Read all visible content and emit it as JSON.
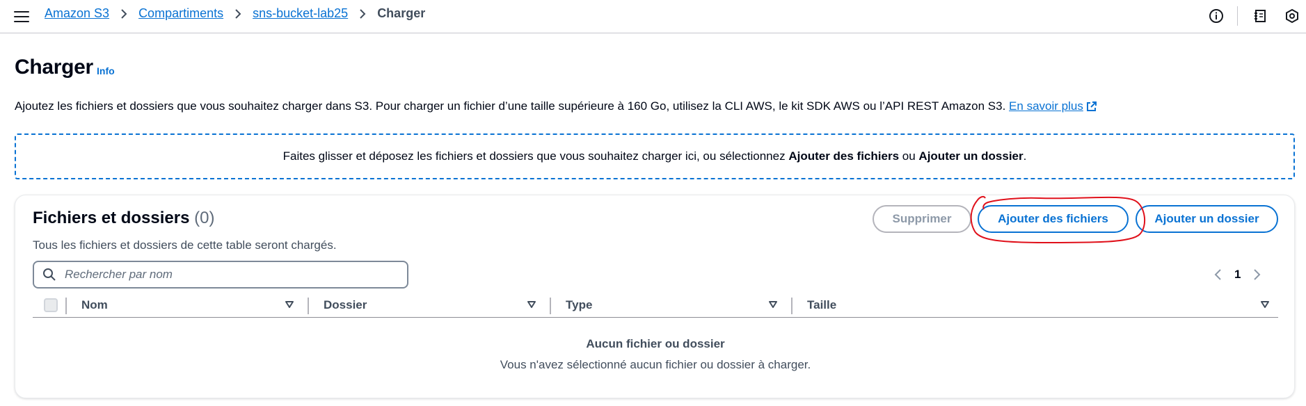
{
  "breadcrumb": {
    "items": [
      "Amazon S3",
      "Compartiments",
      "sns-bucket-lab25"
    ],
    "current": "Charger"
  },
  "header": {
    "title": "Charger",
    "info": "Info",
    "description": "Ajoutez les fichiers et dossiers que vous souhaitez charger dans S3. Pour charger un fichier d’une taille supérieure à 160 Go, utilisez la CLI AWS, le kit SDK AWS ou l’API REST Amazon S3.",
    "learn_more": "En savoir plus"
  },
  "dropzone": {
    "text_before": "Faites glisser et déposez les fichiers et dossiers que vous souhaitez charger ici, ou sélectionnez",
    "bold1": "Ajouter des fichiers",
    "text_mid": "ou",
    "bold2": "Ajouter un dossier",
    "text_end": "."
  },
  "files": {
    "title": "Fichiers et dossiers",
    "count": "(0)",
    "subtitle": "Tous les fichiers et dossiers de cette table seront chargés.",
    "buttons": {
      "delete": "Supprimer",
      "add_files": "Ajouter des fichiers",
      "add_folder": "Ajouter un dossier"
    },
    "search_placeholder": "Rechercher par nom",
    "page": "1",
    "columns": [
      "Nom",
      "Dossier",
      "Type",
      "Taille"
    ],
    "empty_title": "Aucun fichier ou dossier",
    "empty_text": "Vous n'avez sélectionné aucun fichier ou dossier à charger."
  },
  "colors": {
    "link": "#0972d3",
    "annotation": "#e0111b",
    "text": "#000716"
  }
}
